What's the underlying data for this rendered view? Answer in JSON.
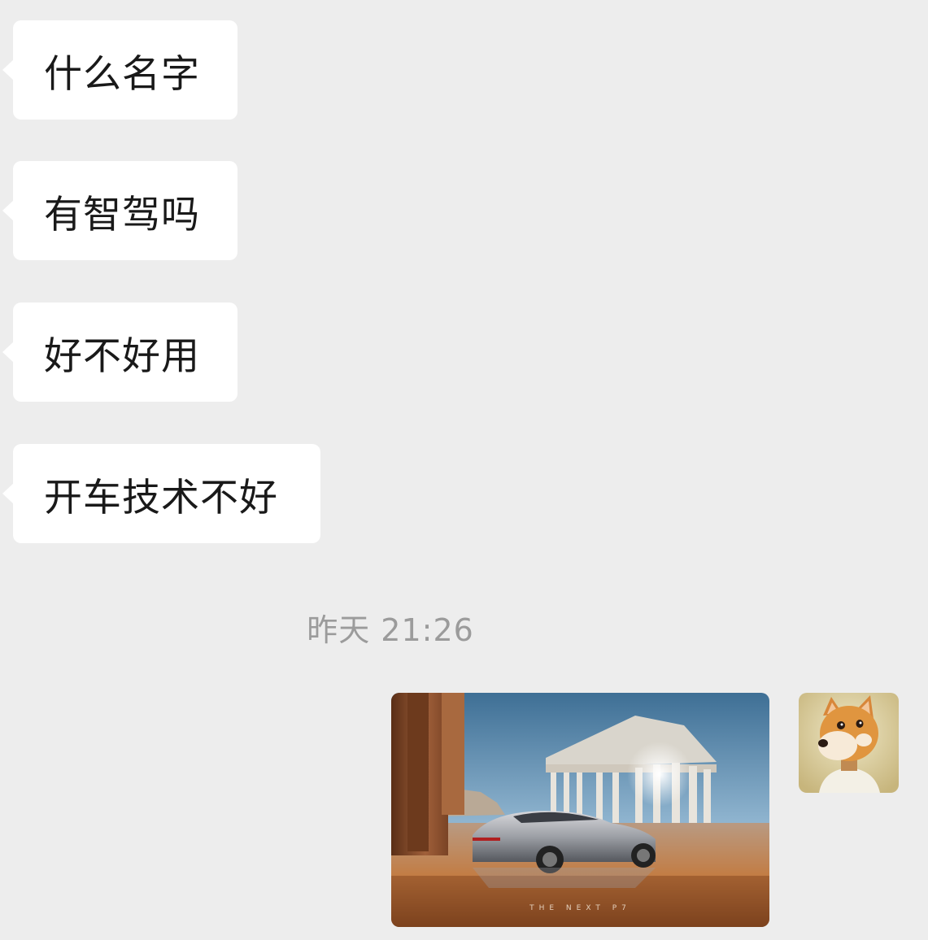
{
  "messages": [
    {
      "side": "left",
      "text": "什么名字"
    },
    {
      "side": "left",
      "text": "有智驾吗"
    },
    {
      "side": "left",
      "text": "好不好用"
    },
    {
      "side": "left",
      "text": "开车技术不好"
    }
  ],
  "timestamp": "昨天 21:26",
  "image_message": {
    "side": "right",
    "caption": "THE NEXT P7"
  },
  "avatar": {
    "icon": "shiba-dog-avatar"
  },
  "colors": {
    "background": "#ededed",
    "bubble": "#ffffff",
    "text": "#191919",
    "timestamp": "#9b9b9b"
  }
}
